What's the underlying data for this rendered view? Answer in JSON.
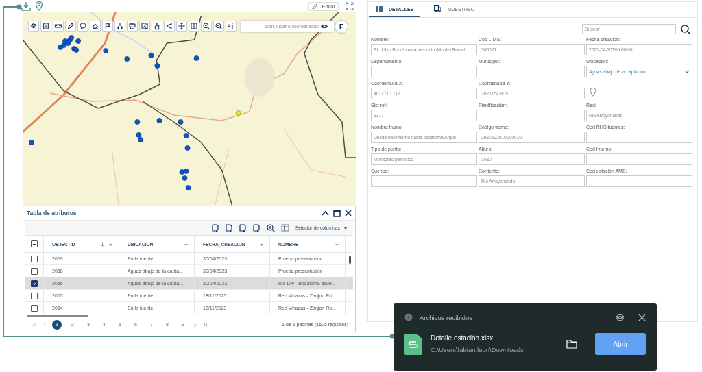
{
  "map_panel": {
    "edit_button": "Editar",
    "search": {
      "placeholder": "ción, lugar o coordenadas"
    },
    "user_button": "F"
  },
  "attribute_table": {
    "title": "Tabla de atributos",
    "column_selector": "Selector de columnas",
    "select_all": {
      "indeterminate": true
    },
    "columns": [
      "OBJECTID",
      "UBICACION",
      "FECHA_CREACION",
      "NOMBRE"
    ],
    "rows": [
      {
        "cells": [
          "2069",
          "En la fuente",
          "30/04/2023",
          "Prueba presentacion"
        ],
        "checked": false,
        "selected": false
      },
      {
        "cells": [
          "2068",
          "Aguas abajo de la capta...",
          "30/04/2023",
          "Prueba presentación"
        ],
        "checked": false,
        "selected": false
      },
      {
        "cells": [
          "2066",
          "Aguas abajo de la capta...",
          "30/04/2023",
          "Rio Lily - Bocatoma acue..."
        ],
        "checked": true,
        "selected": true
      },
      {
        "cells": [
          "2065",
          "En la fuente",
          "18/11/2023",
          "Red Vinazas - Zanjon Ro..."
        ],
        "checked": false,
        "selected": false
      },
      {
        "cells": [
          "2064",
          "En la fuente",
          "18/11/2023",
          "Red Vinazas - Zanjon Ro..."
        ],
        "checked": false,
        "selected": false
      }
    ],
    "pages": [
      {
        "label": "1",
        "selected": true
      },
      {
        "label": "2",
        "selected": false
      },
      {
        "label": "3",
        "selected": false
      },
      {
        "label": "4",
        "selected": false
      },
      {
        "label": "5",
        "selected": false
      },
      {
        "label": "6",
        "selected": false
      },
      {
        "label": "7",
        "selected": false
      },
      {
        "label": "8",
        "selected": false
      },
      {
        "label": "9",
        "selected": false
      }
    ],
    "page_info": "1 de 9 páginas (1605 registros)"
  },
  "details_panel": {
    "tabs": [
      {
        "label": "DETALLES",
        "selected": true
      },
      {
        "label": "MUESTREO",
        "selected": false
      }
    ],
    "search": {
      "placeholder": "Buscar"
    },
    "fields": [
      {
        "kind": "text",
        "label": "Nombre:",
        "value": "Rio Lily - Bocatoma acueducto Alto del Rosari"
      },
      {
        "kind": "text",
        "label": "Cod LIMS:",
        "value": "500001"
      },
      {
        "kind": "text",
        "label": "Fecha creación:",
        "value": "2023-04-30T00:00:00"
      },
      {
        "kind": "text",
        "label": "Departamento:"
      },
      {
        "kind": "text",
        "label": "Municipio:"
      },
      {
        "kind": "select",
        "label": "Ubicación:",
        "value": "Aguas abajo de la captacion"
      },
      {
        "kind": "text",
        "label": "Coordenada X:",
        "value": "4672710.717"
      },
      {
        "kind": "text",
        "label": "Coordenada Y:",
        "value": "2027154.809"
      },
      {
        "kind": "pin"
      },
      {
        "kind": "text",
        "label": "Sist ref:",
        "value": "9377"
      },
      {
        "kind": "text",
        "label": "Planificación:",
        "value": "---"
      },
      {
        "kind": "text",
        "label": "Red:",
        "value": "Rio Arroyohondo"
      },
      {
        "kind": "text",
        "label": "Nombre tramo:",
        "value": "Desde nacimiento hasta bocatoma Argos"
      },
      {
        "kind": "text",
        "label": "Código tramo:",
        "value": "2630223010000010"
      },
      {
        "kind": "text",
        "label": "Cod RHS fuentes:"
      },
      {
        "kind": "text",
        "label": "Tipo de punto:",
        "value": "Monitoreo periodico"
      },
      {
        "kind": "text",
        "label": "Altura:",
        "value": "1030"
      },
      {
        "kind": "text",
        "label": "Cod Interno:"
      },
      {
        "kind": "text",
        "label": "Cuenca:"
      },
      {
        "kind": "text",
        "label": "Corriente:",
        "value": "Rio Arroyohondo"
      },
      {
        "kind": "text",
        "label": "Cod estación AMB:"
      }
    ]
  },
  "download_notification": {
    "title": "Archivos recibidos",
    "file_name": "Detalle estación.xlsx",
    "path": "C:\\Users\\fabian.leon\\Downloads",
    "open_button": "Abrir"
  }
}
